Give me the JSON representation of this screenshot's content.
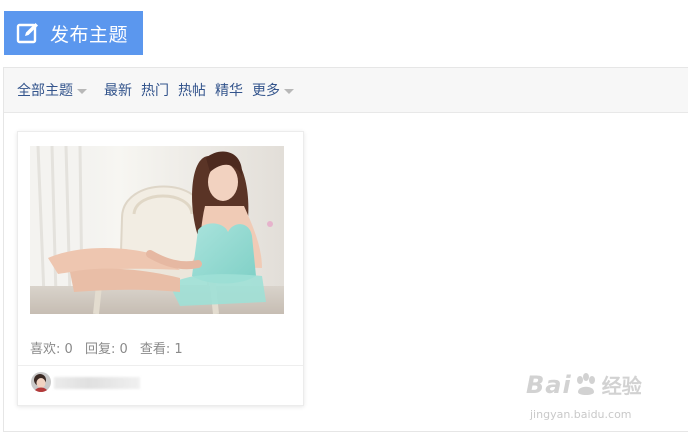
{
  "toolbar": {
    "post_button_label": "发布主题",
    "post_icon": "edit-icon"
  },
  "filters": {
    "all_label": "全部主题",
    "latest_label": "最新",
    "hot_label": "热门",
    "hot_posts_label": "热帖",
    "featured_label": "精华",
    "more_label": "更多"
  },
  "thread_card": {
    "image_alt": "photo of woman in mint green lingerie seated on a white chair",
    "stats": {
      "likes": "喜欢: 0",
      "replies": "回复: 0",
      "views": "查看: 1"
    },
    "author_avatar": "avatar"
  },
  "watermark": {
    "logo": "Bai经验",
    "url": "jingyan.baidu.com"
  },
  "colors": {
    "post_button_bg": "#5b97ee",
    "filter_link": "#33548c",
    "stats_text": "#8a8a8a"
  }
}
